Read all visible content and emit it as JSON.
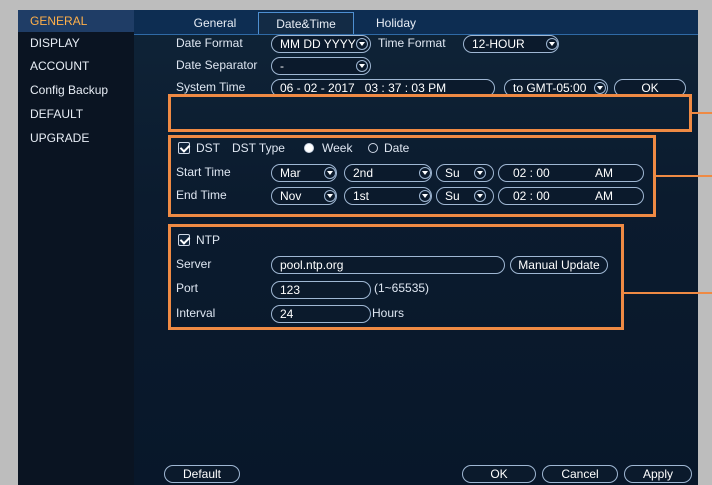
{
  "sidebar": {
    "items": [
      {
        "label": "GENERAL"
      },
      {
        "label": "DISPLAY"
      },
      {
        "label": "ACCOUNT"
      },
      {
        "label": "Config Backup"
      },
      {
        "label": "DEFAULT"
      },
      {
        "label": "UPGRADE"
      }
    ],
    "active_index": 0
  },
  "tabs": [
    {
      "label": "General"
    },
    {
      "label": "Date&Time"
    },
    {
      "label": "Holiday"
    }
  ],
  "active_tab": "Date&Time",
  "date_format": {
    "label": "Date Format",
    "value": "MM DD YYYY"
  },
  "time_format": {
    "label": "Time Format",
    "value": "12-HOUR"
  },
  "date_separator": {
    "label": "Date Separator",
    "value": "-"
  },
  "system_time": {
    "label": "System Time",
    "date": "06 - 02 - 2017",
    "time": "03 : 37 : 03  PM",
    "timezone": "to GMT-05:00",
    "ok_label": "OK"
  },
  "dst": {
    "checked": true,
    "label": "DST",
    "type_label": "DST Type",
    "week_label": "Week",
    "date_label": "Date",
    "selected_type": "Week",
    "start": {
      "label": "Start Time",
      "month": "Mar",
      "week": "2nd",
      "day": "Su",
      "time": "02 : 00",
      "ampm": "AM"
    },
    "end": {
      "label": "End Time",
      "month": "Nov",
      "week": "1st",
      "day": "Su",
      "time": "02 : 00",
      "ampm": "AM"
    }
  },
  "ntp": {
    "checked": true,
    "label": "NTP",
    "server_label": "Server",
    "server_value": "pool.ntp.org",
    "manual_update_label": "Manual Update",
    "port_label": "Port",
    "port_value": "123",
    "port_range": "(1~65535)",
    "interval_label": "Interval",
    "interval_value": "24",
    "interval_unit": "Hours"
  },
  "footer": {
    "default_label": "Default",
    "ok_label": "OK",
    "cancel_label": "Cancel",
    "apply_label": "Apply"
  },
  "colors": {
    "highlight": "#ef8a44",
    "active_sidebar_text": "#ffb04a",
    "panel_bg": "#0b1a2c"
  }
}
